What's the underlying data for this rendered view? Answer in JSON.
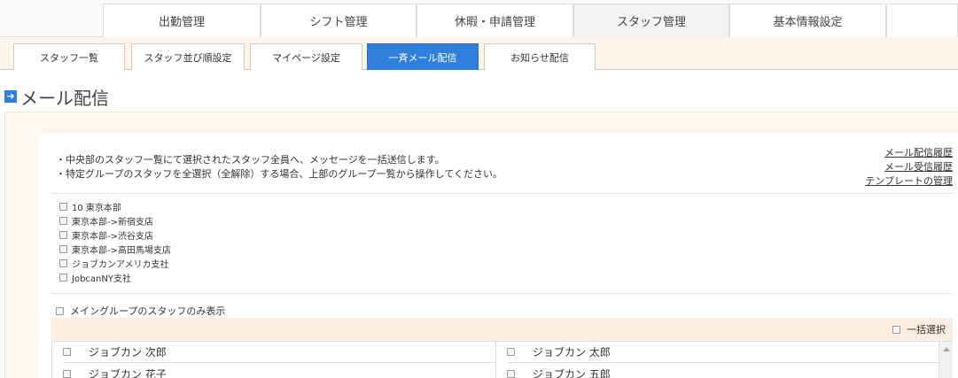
{
  "top_nav": [
    {
      "label": "出勤管理",
      "active": false
    },
    {
      "label": "シフト管理",
      "active": false
    },
    {
      "label": "休暇・申請管理",
      "active": false
    },
    {
      "label": "スタッフ管理",
      "active": true
    },
    {
      "label": "基本情報設定",
      "active": false
    }
  ],
  "sub_nav": [
    {
      "label": "スタッフ一覧",
      "active": false
    },
    {
      "label": "スタッフ並び順設定",
      "active": false
    },
    {
      "label": "マイページ設定",
      "active": false
    },
    {
      "label": "一斉メール配信",
      "active": true
    },
    {
      "label": "お知らせ配信",
      "active": false
    }
  ],
  "page_title": "メール配信",
  "info": [
    "・中央部のスタッフ一覧にて選択されたスタッフ全員へ、メッセージを一括送信します。",
    "・特定グループのスタッフを全選択（全解除）する場合、上部のグループ一覧から操作してください。"
  ],
  "links": [
    "メール配信履歴",
    "メール受信履歴",
    "テンプレートの管理"
  ],
  "groups": [
    "10 東京本部",
    "東京本部->新宿支店",
    "東京本部->渋谷支店",
    "東京本部->高田馬場支店",
    "ジョブカンアメリカ支社",
    "JobcanNY支社"
  ],
  "main_group_only_label": "メイングループのスタッフのみ表示",
  "select_all_label": "一括選択",
  "staff": [
    "ジョブカン 次郎",
    "ジョブカン 太郎",
    "ジョブカン 花子",
    "ジョブカン 五郎"
  ],
  "colors": {
    "accent": "#2f7fdc",
    "subnav_bg": "#fdf6e8",
    "select_bar": "#fbeee0"
  }
}
